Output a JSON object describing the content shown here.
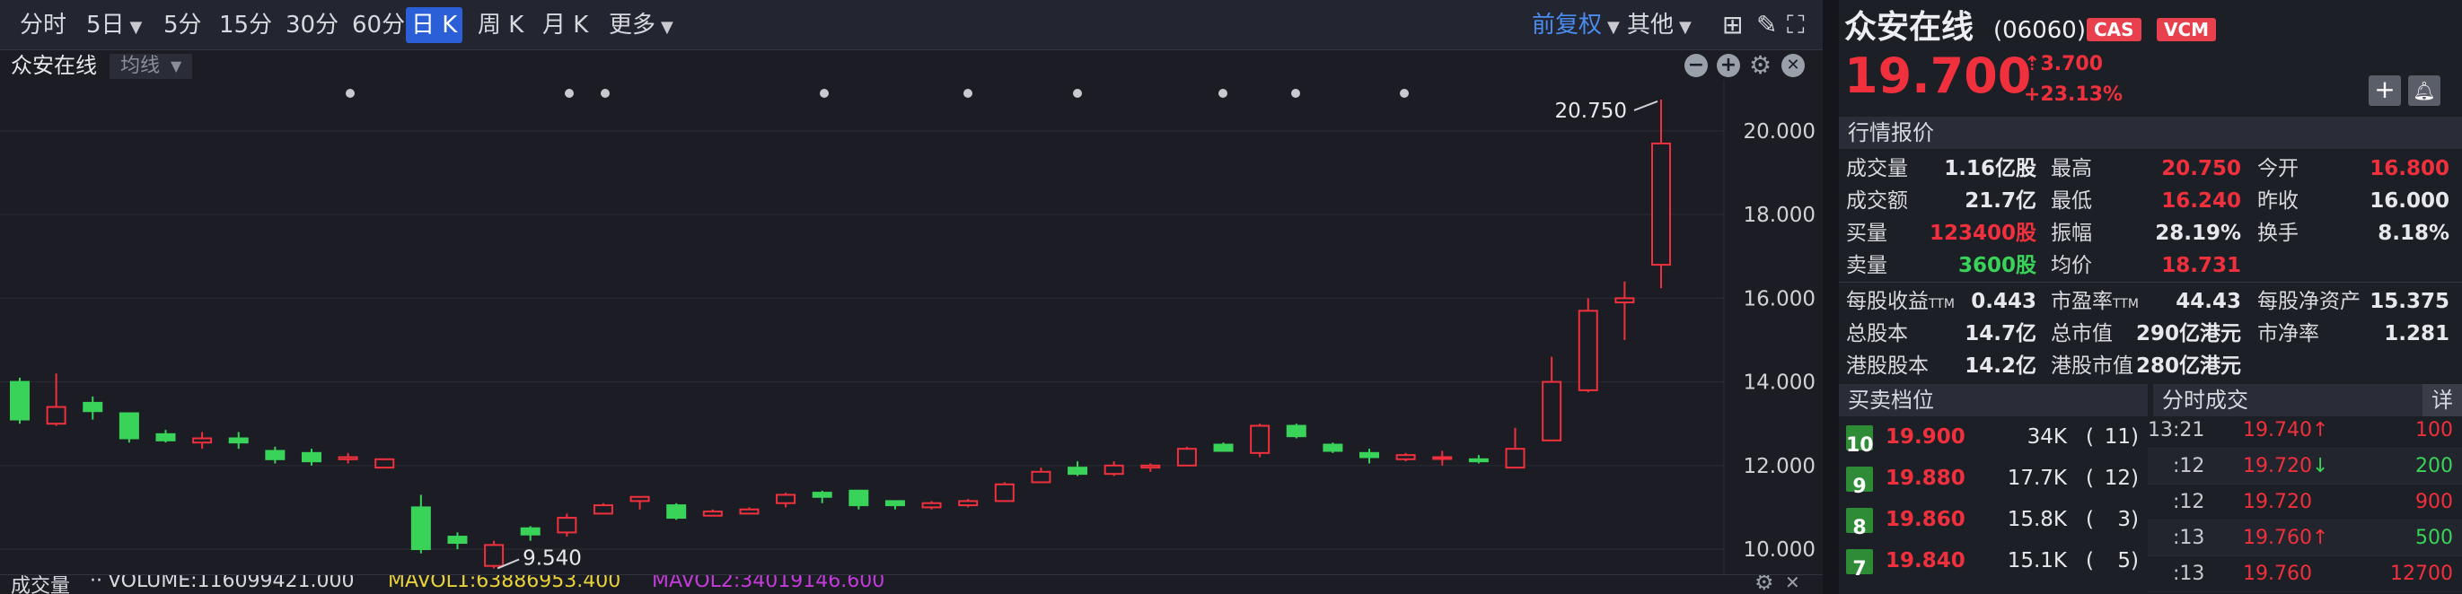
{
  "toolbar": {
    "items": [
      {
        "label": "分时",
        "dropdown": false,
        "active": false
      },
      {
        "label": "5日",
        "dropdown": true,
        "active": false
      },
      {
        "label": "5分",
        "dropdown": false,
        "active": false
      },
      {
        "label": "15分",
        "dropdown": false,
        "active": false
      },
      {
        "label": "30分",
        "dropdown": false,
        "active": false
      },
      {
        "label": "60分",
        "dropdown": false,
        "active": false
      },
      {
        "label": "日 K",
        "dropdown": false,
        "active": true
      },
      {
        "label": "周 K",
        "dropdown": false,
        "active": false
      },
      {
        "label": "月 K",
        "dropdown": false,
        "active": false
      },
      {
        "label": "更多",
        "dropdown": true,
        "active": false
      }
    ],
    "adjust_label": "前复权",
    "other_label": "其他",
    "accent_color": "#2a5fd8"
  },
  "chart_header": {
    "stock_name": "众安在线",
    "ma_label": "均线"
  },
  "chart_data": {
    "type": "candlestick",
    "ylim": [
      9.4,
      21.2
    ],
    "yticks": [
      10.0,
      12.0,
      14.0,
      16.0,
      18.0,
      20.0
    ],
    "up_color": "#f0303c",
    "down_color": "#3ad35a",
    "max_annotation": "20.750",
    "min_annotation": "9.540",
    "candles": [
      {
        "o": 14.0,
        "h": 14.1,
        "l": 13.0,
        "c": 13.1
      },
      {
        "o": 13.0,
        "h": 14.2,
        "l": 12.95,
        "c": 13.4
      },
      {
        "o": 13.5,
        "h": 13.65,
        "l": 13.1,
        "c": 13.3
      },
      {
        "o": 13.25,
        "h": 13.25,
        "l": 12.55,
        "c": 12.65
      },
      {
        "o": 12.75,
        "h": 12.85,
        "l": 12.55,
        "c": 12.6
      },
      {
        "o": 12.55,
        "h": 12.8,
        "l": 12.4,
        "c": 12.65
      },
      {
        "o": 12.65,
        "h": 12.8,
        "l": 12.4,
        "c": 12.55
      },
      {
        "o": 12.35,
        "h": 12.45,
        "l": 12.05,
        "c": 12.15
      },
      {
        "o": 12.3,
        "h": 12.4,
        "l": 12.0,
        "c": 12.1
      },
      {
        "o": 12.15,
        "h": 12.3,
        "l": 12.05,
        "c": 12.2
      },
      {
        "o": 11.95,
        "h": 12.15,
        "l": 11.95,
        "c": 12.15
      },
      {
        "o": 11.0,
        "h": 11.3,
        "l": 9.9,
        "c": 10.0
      },
      {
        "o": 10.3,
        "h": 10.4,
        "l": 10.0,
        "c": 10.15
      },
      {
        "o": 9.6,
        "h": 10.2,
        "l": 9.54,
        "c": 10.1
      },
      {
        "o": 10.5,
        "h": 10.55,
        "l": 10.2,
        "c": 10.35
      },
      {
        "o": 10.4,
        "h": 10.85,
        "l": 10.3,
        "c": 10.75
      },
      {
        "o": 10.85,
        "h": 11.1,
        "l": 10.85,
        "c": 11.05
      },
      {
        "o": 11.15,
        "h": 11.25,
        "l": 10.95,
        "c": 11.25
      },
      {
        "o": 11.05,
        "h": 11.1,
        "l": 10.7,
        "c": 10.75
      },
      {
        "o": 10.8,
        "h": 10.95,
        "l": 10.8,
        "c": 10.9
      },
      {
        "o": 10.85,
        "h": 11.0,
        "l": 10.85,
        "c": 10.95
      },
      {
        "o": 11.1,
        "h": 11.35,
        "l": 11.0,
        "c": 11.3
      },
      {
        "o": 11.35,
        "h": 11.4,
        "l": 11.1,
        "c": 11.25
      },
      {
        "o": 11.4,
        "h": 11.4,
        "l": 10.95,
        "c": 11.05
      },
      {
        "o": 11.15,
        "h": 11.15,
        "l": 10.95,
        "c": 11.05
      },
      {
        "o": 11.0,
        "h": 11.15,
        "l": 10.95,
        "c": 11.1
      },
      {
        "o": 11.05,
        "h": 11.2,
        "l": 11.0,
        "c": 11.15
      },
      {
        "o": 11.15,
        "h": 11.6,
        "l": 11.15,
        "c": 11.55
      },
      {
        "o": 11.6,
        "h": 11.95,
        "l": 11.6,
        "c": 11.85
      },
      {
        "o": 11.95,
        "h": 12.1,
        "l": 11.75,
        "c": 11.8
      },
      {
        "o": 11.8,
        "h": 12.1,
        "l": 11.75,
        "c": 12.0
      },
      {
        "o": 11.95,
        "h": 12.05,
        "l": 11.85,
        "c": 12.0
      },
      {
        "o": 12.0,
        "h": 12.45,
        "l": 12.0,
        "c": 12.4
      },
      {
        "o": 12.5,
        "h": 12.55,
        "l": 12.35,
        "c": 12.35
      },
      {
        "o": 12.3,
        "h": 13.0,
        "l": 12.2,
        "c": 12.95
      },
      {
        "o": 12.95,
        "h": 13.0,
        "l": 12.65,
        "c": 12.7
      },
      {
        "o": 12.5,
        "h": 12.55,
        "l": 12.3,
        "c": 12.35
      },
      {
        "o": 12.3,
        "h": 12.4,
        "l": 12.05,
        "c": 12.2
      },
      {
        "o": 12.15,
        "h": 12.3,
        "l": 12.1,
        "c": 12.25
      },
      {
        "o": 12.2,
        "h": 12.35,
        "l": 12.0,
        "c": 12.2
      },
      {
        "o": 12.15,
        "h": 12.25,
        "l": 12.05,
        "c": 12.1
      },
      {
        "o": 11.95,
        "h": 12.9,
        "l": 11.95,
        "c": 12.4
      },
      {
        "o": 12.6,
        "h": 14.6,
        "l": 12.6,
        "c": 14.0
      },
      {
        "o": 13.8,
        "h": 16.0,
        "l": 13.75,
        "c": 15.7
      },
      {
        "o": 15.9,
        "h": 16.4,
        "l": 15.0,
        "c": 16.0
      },
      {
        "o": 16.8,
        "h": 20.75,
        "l": 16.24,
        "c": 19.7
      }
    ]
  },
  "volume_bar": {
    "title": "成交量",
    "volume_label": "VOLUME:116099421.000",
    "mavol1_label": "MAVOL1:63886953.400",
    "mavol2_label": "MAVOL2:34019146.600",
    "mavol1_color": "#e8d13a",
    "mavol2_color": "#c43adb"
  },
  "quote": {
    "name": "众安在线",
    "code": "(06060)",
    "badges": [
      "CAS",
      "VCM"
    ],
    "price": "19.700",
    "change": "3.700",
    "change_pct": "+23.13%",
    "section_title": "行情报价",
    "rows": [
      [
        {
          "label": "成交量",
          "value": "1.16亿股",
          "color": ""
        },
        {
          "label": "最高",
          "value": "20.750",
          "color": "red"
        },
        {
          "label": "今开",
          "value": "16.800",
          "color": "red"
        }
      ],
      [
        {
          "label": "成交额",
          "value": "21.7亿",
          "color": ""
        },
        {
          "label": "最低",
          "value": "16.240",
          "color": "red"
        },
        {
          "label": "昨收",
          "value": "16.000",
          "color": ""
        }
      ],
      [
        {
          "label": "买量",
          "value": "123400股",
          "color": "red"
        },
        {
          "label": "振幅",
          "value": "28.19%",
          "color": ""
        },
        {
          "label": "换手",
          "value": "8.18%",
          "color": ""
        }
      ],
      [
        {
          "label": "卖量",
          "value": "3600股",
          "color": "green"
        },
        {
          "label": "均价",
          "value": "18.731",
          "color": "red"
        },
        {
          "label": "",
          "value": "",
          "color": ""
        }
      ],
      [
        {
          "label": "每股收益",
          "sub": "TTM",
          "value": "0.443",
          "color": ""
        },
        {
          "label": "市盈率",
          "sub": "TTM",
          "value": "44.43",
          "color": ""
        },
        {
          "label": "每股净资产",
          "value": "15.375",
          "color": ""
        }
      ],
      [
        {
          "label": "总股本",
          "value": "14.7亿",
          "color": ""
        },
        {
          "label": "总市值",
          "value": "290亿港元",
          "color": ""
        },
        {
          "label": "市净率",
          "value": "1.281",
          "color": ""
        }
      ],
      [
        {
          "label": "港股股本",
          "value": "14.2亿",
          "color": ""
        },
        {
          "label": "港股市值",
          "value": "280亿港元",
          "color": ""
        },
        {
          "label": "",
          "value": "",
          "color": ""
        }
      ]
    ]
  },
  "order_book": {
    "title": "买卖档位",
    "rows": [
      {
        "level": "10",
        "price": "19.900",
        "volume": "34K",
        "count": "11)"
      },
      {
        "level": "9",
        "price": "19.880",
        "volume": "17.7K",
        "count": "12)"
      },
      {
        "level": "8",
        "price": "19.860",
        "volume": "15.8K",
        "count": "3)"
      },
      {
        "level": "7",
        "price": "19.840",
        "volume": "15.1K",
        "count": "5)"
      }
    ]
  },
  "trades": {
    "title": "分时成交",
    "detail_label": "详",
    "rows": [
      {
        "time": "13:21",
        "price": "19.740",
        "dir": "up",
        "volume": "100"
      },
      {
        "time": ":12",
        "price": "19.720",
        "dir": "down",
        "volume": "200"
      },
      {
        "time": ":12",
        "price": "19.720",
        "dir": "",
        "volume": "900"
      },
      {
        "time": ":13",
        "price": "19.760",
        "dir": "up",
        "volume": "500"
      },
      {
        "time": ":13",
        "price": "19.760",
        "dir": "",
        "volume": "12700"
      }
    ]
  }
}
